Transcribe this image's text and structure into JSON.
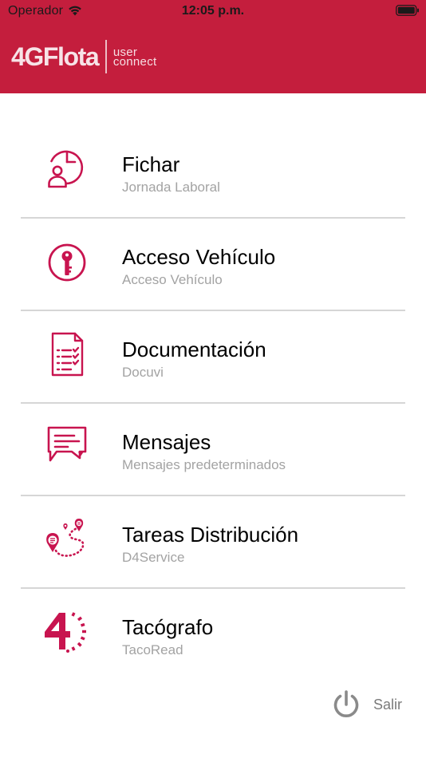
{
  "status_bar": {
    "carrier": "Operador",
    "time": "12:05 p.m."
  },
  "header": {
    "logo_main": "4GFlota",
    "logo_sub_line1": "user",
    "logo_sub_line2": "connect"
  },
  "colors": {
    "brand": "#c41e3d",
    "icon_accent": "#c8144f",
    "subtitle_gray": "#a3a3a3"
  },
  "menu": {
    "items": [
      {
        "title": "Fichar",
        "subtitle": "Jornada Laboral",
        "icon": "clock-user-icon"
      },
      {
        "title": "Acceso Vehículo",
        "subtitle": "Acceso Vehículo",
        "icon": "key-icon"
      },
      {
        "title": "Documentación",
        "subtitle": "Docuvi",
        "icon": "checklist-document-icon"
      },
      {
        "title": "Mensajes",
        "subtitle": "Mensajes predeterminados",
        "icon": "message-bubble-icon"
      },
      {
        "title": "Tareas Distribución",
        "subtitle": "D4Service",
        "icon": "route-pins-icon"
      },
      {
        "title": "Tacógrafo",
        "subtitle": "TacoRead",
        "icon": "tachograph-four-icon"
      }
    ]
  },
  "logout": {
    "label": "Salir",
    "icon": "power-icon"
  }
}
